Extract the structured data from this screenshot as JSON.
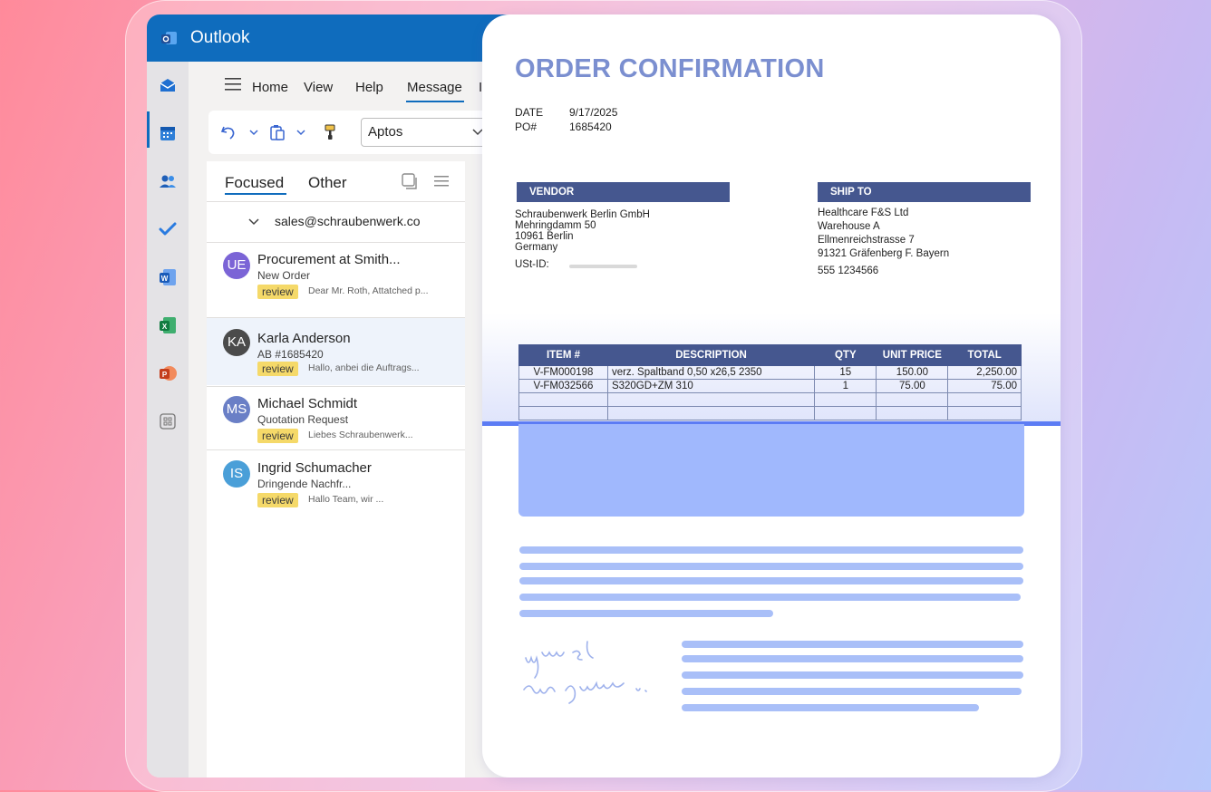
{
  "app": {
    "title": "Outlook"
  },
  "rail": {
    "icons": [
      "mail-icon",
      "calendar-icon",
      "people-icon",
      "todo-icon",
      "word-icon",
      "excel-icon",
      "powerpoint-icon",
      "apps-icon"
    ]
  },
  "menu": {
    "items": [
      "Home",
      "View",
      "Help",
      "Message",
      "I"
    ]
  },
  "toolbar": {
    "font": "Aptos"
  },
  "list": {
    "tabs": [
      "Focused",
      "Other"
    ],
    "account": "sales@schraubenwerk.co",
    "mails": [
      {
        "initials": "UE",
        "color": "#7b64d6",
        "sender": "Procurement at Smith...",
        "subject": "New Order",
        "tag": "review",
        "preview": "Dear Mr. Roth, Attatched p..."
      },
      {
        "initials": "KA",
        "color": "#4b4b4b",
        "sender": "Karla Anderson",
        "subject": "AB #1685420",
        "tag": "review",
        "preview": "Hallo, anbei die Auftrags..."
      },
      {
        "initials": "MS",
        "color": "#6a7fc6",
        "sender": "Michael Schmidt",
        "subject": "Quotation Request",
        "tag": "review",
        "preview": "Liebes Schraubenwerk..."
      },
      {
        "initials": "IS",
        "color": "#4a9fd8",
        "sender": "Ingrid Schumacher",
        "subject": "Dringende Nachfr...",
        "tag": "review",
        "preview": "Hallo Team, wir ..."
      }
    ]
  },
  "doc": {
    "title": "ORDER CONFIRMATION",
    "date_label": "DATE",
    "date": "9/17/2025",
    "po_label": "PO#",
    "po": "1685420",
    "vendor_label": "VENDOR",
    "vendor_lines": [
      "Schraubenwerk Berlin GmbH",
      "Mehringdamm 50",
      "10961 Berlin",
      "Germany"
    ],
    "ust_label": "USt-ID:",
    "shipto_label": "SHIP TO",
    "shipto_lines": [
      "Healthcare F&S Ltd",
      "Warehouse A",
      "Ellmenreichstrasse 7",
      "91321  Gräfenberg F. Bayern"
    ],
    "phone": "555 1234566",
    "table": {
      "headers": [
        "ITEM #",
        "DESCRIPTION",
        "QTY",
        "UNIT PRICE",
        "TOTAL"
      ],
      "rows": [
        [
          "V-FM000198",
          "verz. Spaltband 0,50 x26,5 2350",
          "15",
          "150.00",
          "2,250.00"
        ],
        [
          "V-FM032566",
          "S320GD+ZM 310",
          "1",
          "75.00",
          "75.00"
        ]
      ]
    }
  }
}
